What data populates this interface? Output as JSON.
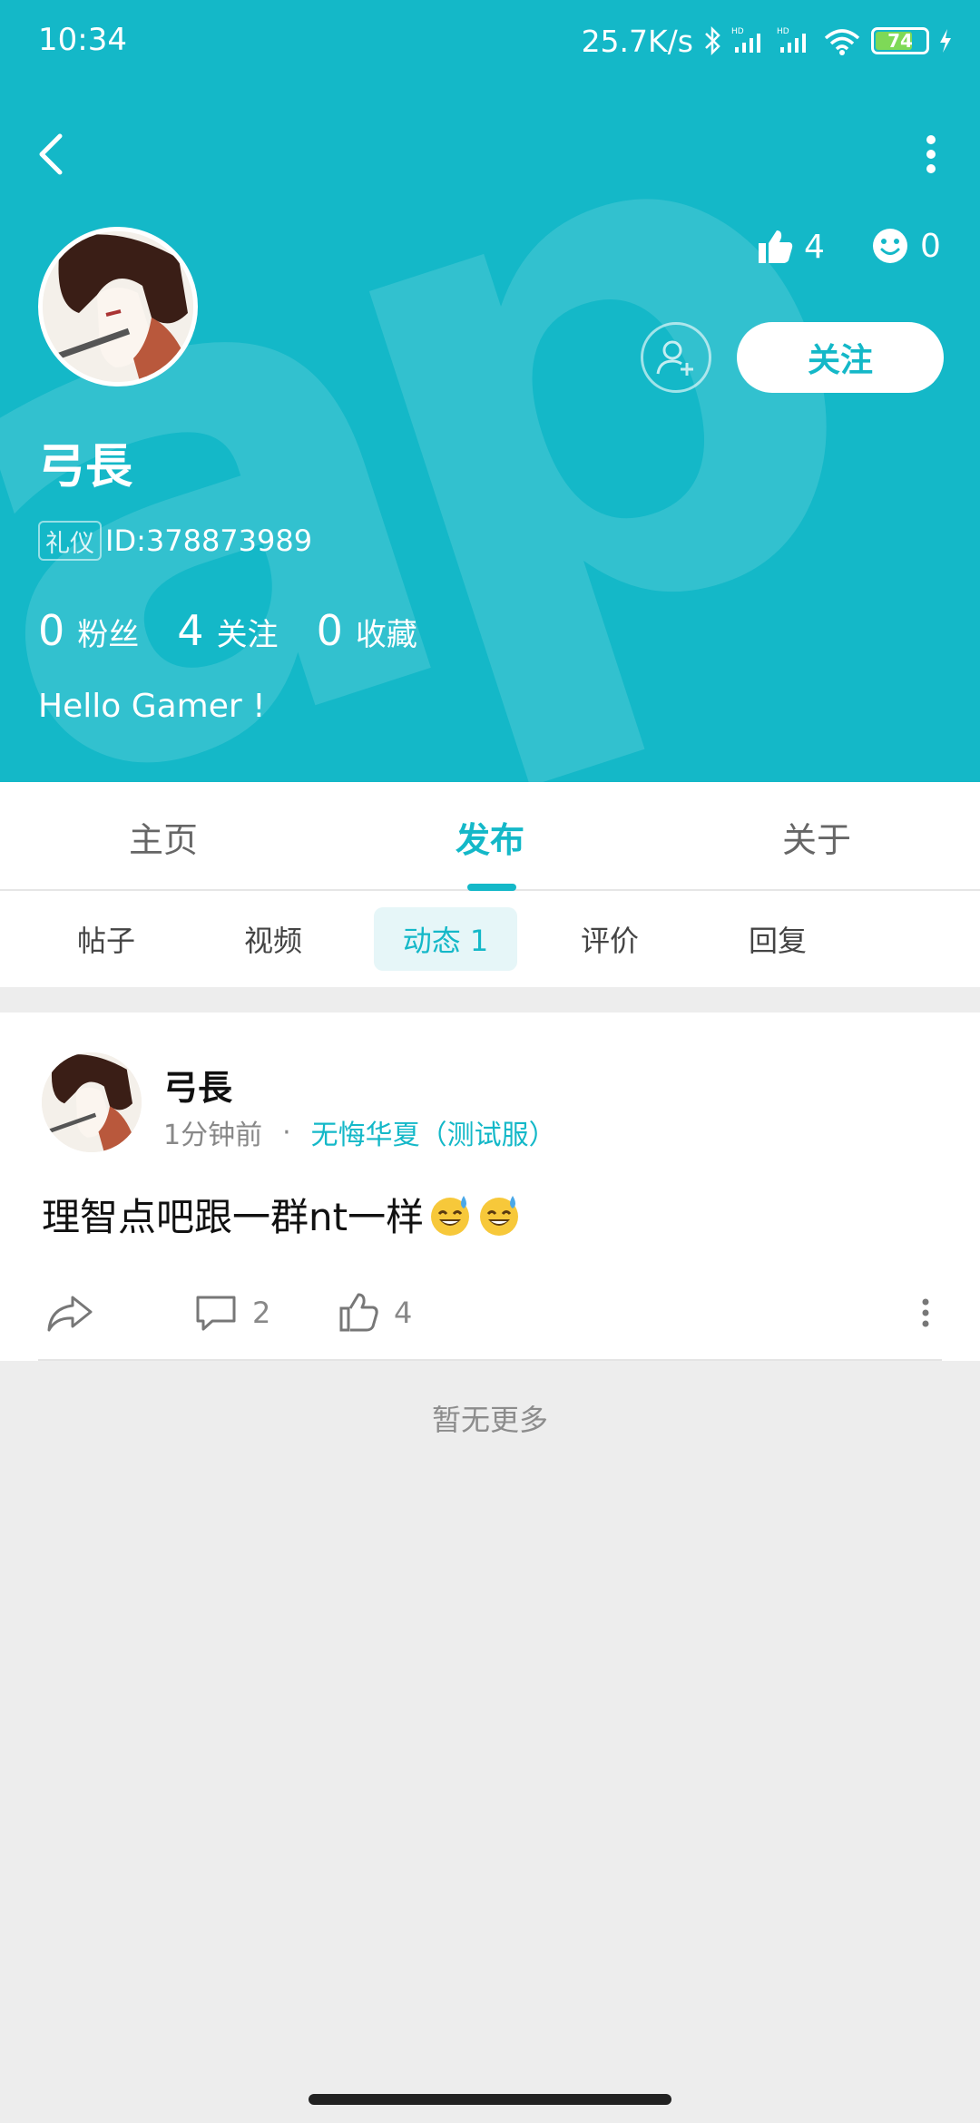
{
  "status_bar": {
    "time": "10:34",
    "net_speed": "25.7K/s",
    "battery": "74",
    "battery_level": 0.74
  },
  "profile": {
    "username": "弓長",
    "badge": "礼仪",
    "id_text": "ID:378873989",
    "likes": "4",
    "smiles": "0",
    "follow_label": "关注",
    "fans_count": "0",
    "fans_label": "粉丝",
    "following_count": "4",
    "following_label": "关注",
    "favorites_count": "0",
    "favorites_label": "收藏",
    "bio": "Hello Gamer !"
  },
  "tabs": [
    {
      "label": "主页",
      "active": false
    },
    {
      "label": "发布",
      "active": true
    },
    {
      "label": "关于",
      "active": false
    }
  ],
  "subtabs": [
    {
      "label": "帖子",
      "active": false
    },
    {
      "label": "视频",
      "active": false
    },
    {
      "label": "动态 1",
      "active": true
    },
    {
      "label": "评价",
      "active": false
    },
    {
      "label": "回复",
      "active": false
    }
  ],
  "post": {
    "author": "弓長",
    "time": "1分钟前",
    "dot": "·",
    "forum": "无悔华夏（测试服）",
    "content": "理智点吧跟一群nt一样",
    "comments": "2",
    "likes": "4"
  },
  "footer": {
    "no_more": "暂无更多"
  },
  "colors": {
    "accent": "#14b8c8",
    "background": "#ededed"
  }
}
